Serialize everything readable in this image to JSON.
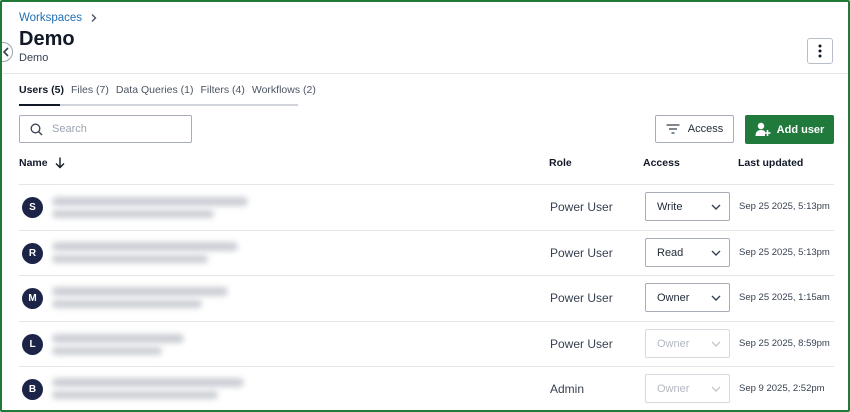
{
  "breadcrumb": {
    "parent": "Workspaces"
  },
  "page": {
    "title": "Demo",
    "subtitle": "Demo"
  },
  "tabs": [
    {
      "label": "Users (5)",
      "active": true
    },
    {
      "label": "Files (7)",
      "active": false
    },
    {
      "label": "Data Queries (1)",
      "active": false
    },
    {
      "label": "Filters (4)",
      "active": false
    },
    {
      "label": "Workflows (2)",
      "active": false
    }
  ],
  "search": {
    "placeholder": "Search",
    "value": ""
  },
  "toolbar": {
    "access_label": "Access",
    "add_user_label": "Add user"
  },
  "table": {
    "headers": {
      "name": "Name",
      "role": "Role",
      "access": "Access",
      "last_updated": "Last updated"
    },
    "sort": {
      "column": "name",
      "direction": "descending"
    },
    "rows": [
      {
        "initial": "S",
        "role": "Power User",
        "access": "Write",
        "access_disabled": false,
        "last_updated": "Sep 25 2025, 5:13pm"
      },
      {
        "initial": "R",
        "role": "Power User",
        "access": "Read",
        "access_disabled": false,
        "last_updated": "Sep 25 2025, 5:13pm"
      },
      {
        "initial": "M",
        "role": "Power User",
        "access": "Owner",
        "access_disabled": false,
        "last_updated": "Sep 25 2025, 1:15am"
      },
      {
        "initial": "L",
        "role": "Power User",
        "access": "Owner",
        "access_disabled": true,
        "last_updated": "Sep 25 2025, 8:59pm"
      },
      {
        "initial": "B",
        "role": "Admin",
        "access": "Owner",
        "access_disabled": true,
        "last_updated": "Sep 9 2025, 2:52pm"
      }
    ]
  },
  "colors": {
    "link": "#1f6fb2",
    "primary_button": "#207a3c",
    "avatar": "#1c2547",
    "frame_border": "#1f7a3a"
  },
  "icons": {
    "collapse": "chevron-left-icon",
    "breadcrumb_separator": "chevron-right-icon",
    "more": "vertical-dots-icon",
    "search": "search-icon",
    "access": "filter-lines-icon",
    "add_user": "add-user-icon",
    "sort": "arrow-down-icon",
    "select": "chevron-down-icon"
  }
}
